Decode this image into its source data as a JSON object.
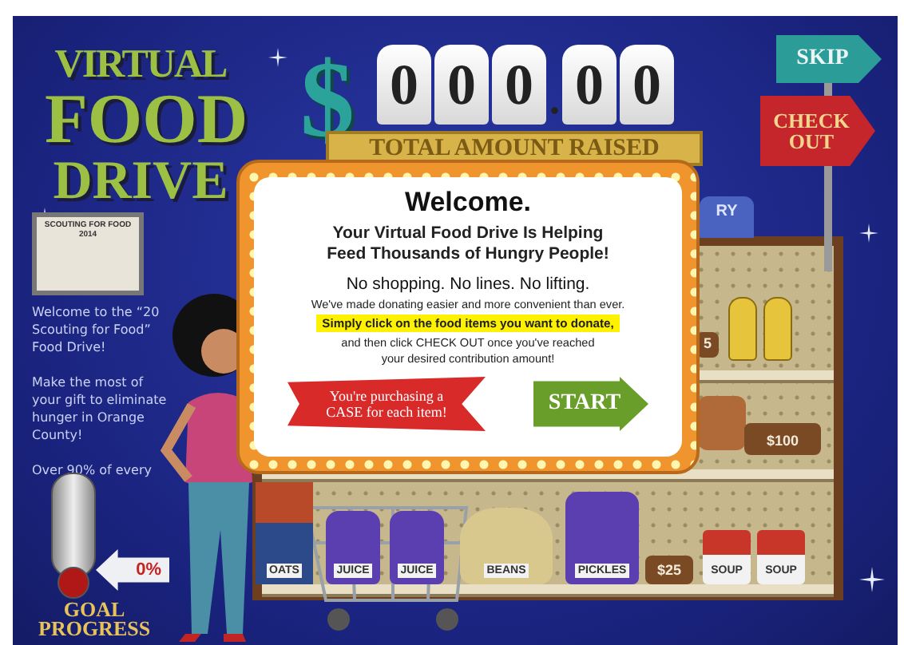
{
  "title": {
    "lines": [
      "VIRTUAL",
      "FOOD",
      "DRIVE"
    ]
  },
  "badge": {
    "title": "SCOUTING FOR FOOD",
    "year": "2014"
  },
  "intro": [
    {
      "lines": [
        "Welcome to the “20",
        "Scouting for Food”",
        "Food Drive!"
      ]
    },
    {
      "lines": [
        "Make the most of",
        "your gift to eliminate",
        "hunger in Orange",
        "County!"
      ]
    },
    {
      "lines": [
        "Over 90% of every"
      ]
    }
  ],
  "progress": {
    "level": 0,
    "reading": "0%",
    "caption": [
      "GOAL",
      "PROGRESS"
    ]
  },
  "counter": {
    "symbol": "$",
    "digits": [
      "0",
      "0",
      "0",
      "0",
      "0"
    ],
    "decimal": ".",
    "caption": "TOTAL AMOUNT RAISED"
  },
  "nav": [
    {
      "label": "SKIP",
      "kind": "skip"
    },
    {
      "label": "CHECK OUT",
      "kind": "checkout"
    }
  ],
  "shelf": {
    "sign": "RY",
    "items": [
      {
        "label": "5",
        "kind": "money"
      },
      {
        "label": "$100",
        "kind": "money"
      },
      {
        "label": "OATS",
        "kind": "box"
      },
      {
        "label": "JUICE",
        "kind": "jar"
      },
      {
        "label": "JUICE",
        "kind": "jar"
      },
      {
        "label": "BEANS",
        "kind": "sack"
      },
      {
        "label": "PICKLES",
        "kind": "jar"
      },
      {
        "label": "$25",
        "kind": "money"
      },
      {
        "label": "SOUP",
        "kind": "can"
      },
      {
        "label": "SOUP",
        "kind": "can"
      }
    ]
  },
  "modal": {
    "heading": "Welcome.",
    "subheading": "Your Virtual Food Drive Is Helping Feed Thousands of Hungry People!",
    "tagline": "No shopping. No lines. No lifting.",
    "body": "We've made donating easier and more convenient than ever.",
    "highlight": "Simply click on the food items you want to donate,",
    "instructions": "and then click CHECK OUT once you've reached your desired contribution amount!",
    "banner": "You're purchasing a CASE for each item!",
    "start": "START"
  }
}
